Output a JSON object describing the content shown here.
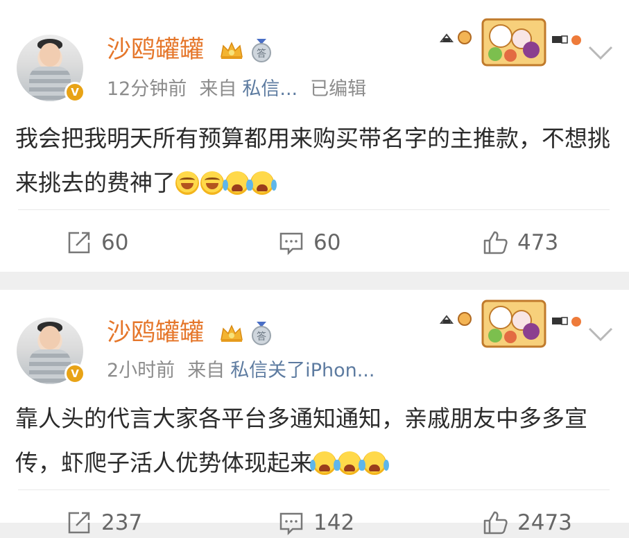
{
  "posts": [
    {
      "author": "沙鸥罐罐",
      "avatar_badge": "V",
      "medal_text": "答",
      "time": "12分钟前",
      "from_label": "来自",
      "source": "私信...",
      "edited": "已编辑",
      "text": "我会把我明天所有预算都用来购买带名字的主推款，不想挑来挑去的费神了",
      "emojis": [
        "grin-icon",
        "grin-icon",
        "cry-icon",
        "cry-icon"
      ],
      "repost_count": "60",
      "comment_count": "60",
      "like_count": "473"
    },
    {
      "author": "沙鸥罐罐",
      "avatar_badge": "V",
      "medal_text": "答",
      "time": "2小时前",
      "from_label": "来自",
      "source": "私信关了iPhon...",
      "text": "靠人头的代言大家各平台多通知通知，亲戚朋友中多多宣传，虾爬子活人优势体现起来",
      "emojis": [
        "cry-icon",
        "cry-icon",
        "cry-icon"
      ],
      "repost_count": "237",
      "comment_count": "142",
      "like_count": "2473"
    }
  ],
  "colors": {
    "author_name": "#e5762a",
    "source_link": "#5d7ba0",
    "meta_text": "#8c8c8c",
    "badge": "#e8a316",
    "background": "#efefef"
  }
}
